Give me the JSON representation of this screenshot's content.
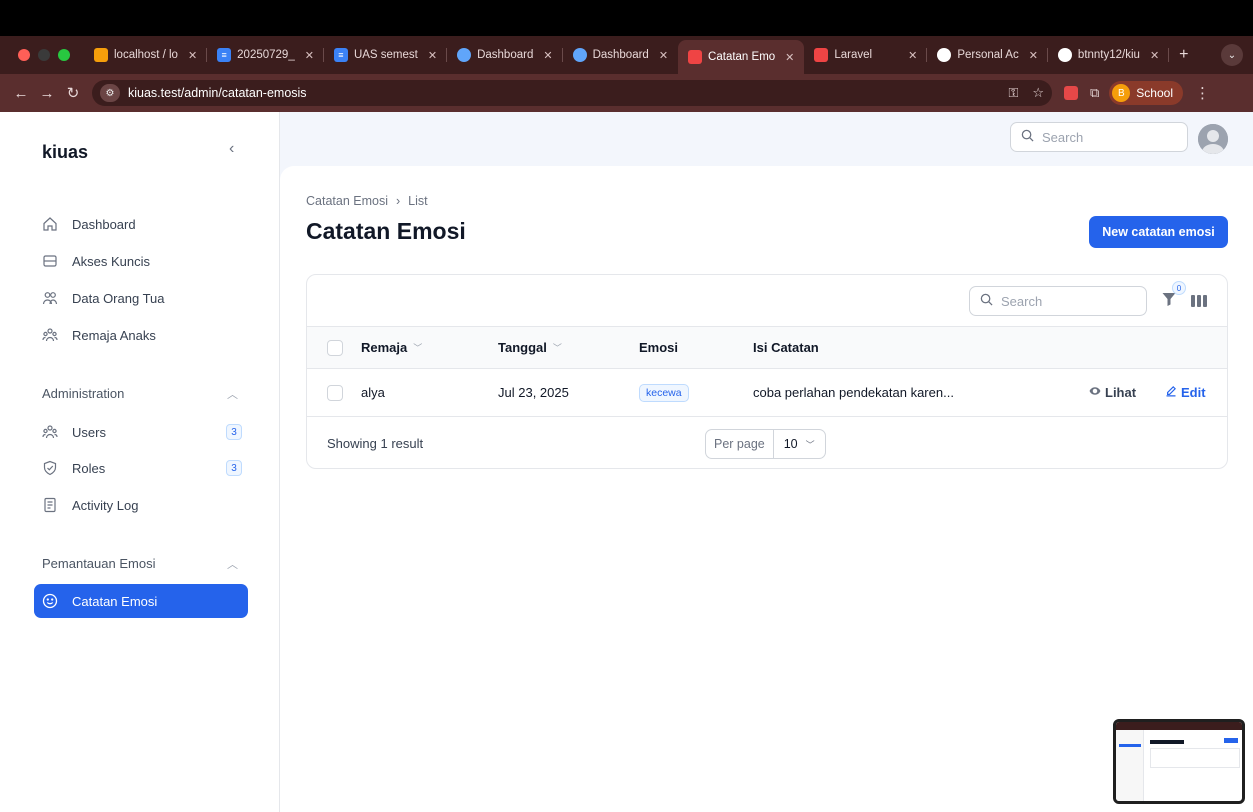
{
  "browser": {
    "tabs": [
      {
        "label": "localhost / lo",
        "icon": "phpmyadmin-icon",
        "color": "#f59e0b"
      },
      {
        "label": "20250729_",
        "icon": "docs-icon",
        "color": "#3b82f6"
      },
      {
        "label": "UAS semest",
        "icon": "docs-icon",
        "color": "#3b82f6"
      },
      {
        "label": "Dashboard",
        "icon": "globe-icon",
        "color": "#60a5fa"
      },
      {
        "label": "Dashboard",
        "icon": "globe-icon",
        "color": "#60a5fa"
      },
      {
        "label": "Catatan Emo",
        "icon": "laravel-icon",
        "color": "#ef4444",
        "active": true
      },
      {
        "label": "Laravel",
        "icon": "laravel-icon",
        "color": "#ef4444"
      },
      {
        "label": "Personal Ac",
        "icon": "github-icon",
        "color": "#ffffff"
      },
      {
        "label": "btnnty12/kiu",
        "icon": "github-icon",
        "color": "#ffffff"
      }
    ],
    "url": "kiuas.test/admin/catatan-emosis",
    "profile": {
      "initial": "B",
      "label": "School"
    }
  },
  "app": {
    "brand": "kiuas",
    "search_placeholder": "Search",
    "nav": [
      {
        "label": "Dashboard",
        "icon": "home-icon"
      },
      {
        "label": "Akses Kuncis",
        "icon": "inbox-icon"
      },
      {
        "label": "Data Orang Tua",
        "icon": "users-icon"
      },
      {
        "label": "Remaja Anaks",
        "icon": "user-group-icon"
      }
    ],
    "groups": [
      {
        "label": "Administration",
        "items": [
          {
            "label": "Users",
            "icon": "users-icon",
            "badge": "3"
          },
          {
            "label": "Roles",
            "icon": "shield-check-icon",
            "badge": "3"
          },
          {
            "label": "Activity Log",
            "icon": "document-icon"
          }
        ]
      },
      {
        "label": "Pemantauan Emosi",
        "items": [
          {
            "label": "Catatan Emosi",
            "icon": "smile-icon",
            "active": true
          }
        ]
      }
    ]
  },
  "page": {
    "breadcrumb": [
      "Catatan Emosi",
      "List"
    ],
    "title": "Catatan Emosi",
    "new_button": "New catatan emosi",
    "table": {
      "search_placeholder": "Search",
      "filter_count": "0",
      "columns": [
        "Remaja",
        "Tanggal",
        "Emosi",
        "Isi Catatan"
      ],
      "rows": [
        {
          "remaja": "alya",
          "tanggal": "Jul 23, 2025",
          "emosi": "kecewa",
          "isi": "coba perlahan pendekatan karen..."
        }
      ],
      "actions": {
        "view": "Lihat",
        "edit": "Edit"
      },
      "summary": "Showing 1 result",
      "per_page_label": "Per page",
      "per_page_value": "10"
    }
  },
  "colors": {
    "primary": "#2563eb",
    "chrome": "#3b1d1d"
  }
}
